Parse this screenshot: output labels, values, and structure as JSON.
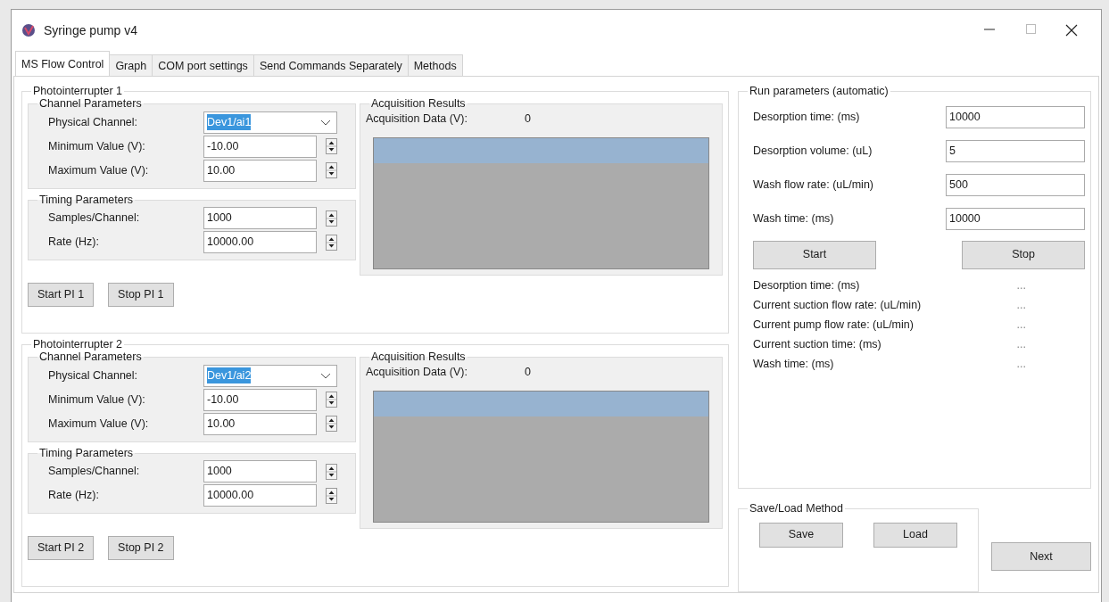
{
  "window": {
    "title": "Syringe pump v4"
  },
  "tabs": [
    {
      "label": "MS Flow Control",
      "selected": true
    },
    {
      "label": "Graph",
      "selected": false
    },
    {
      "label": "COM port settings",
      "selected": false
    },
    {
      "label": "Send Commands Separately",
      "selected": false
    },
    {
      "label": "Methods",
      "selected": false
    }
  ],
  "interrupters": [
    {
      "title": "Photointerrupter 1",
      "channel_params": {
        "title": "Channel Parameters",
        "physical_channel": {
          "label": "Physical Channel:",
          "value": "Dev1/ai1",
          "text_selected": true
        },
        "fields": [
          {
            "label": "Minimum Value (V):",
            "value": "-10.00"
          },
          {
            "label": "Maximum Value (V):",
            "value": "10.00"
          }
        ]
      },
      "timing": {
        "title": "Timing Parameters",
        "fields": [
          {
            "label": "Samples/Channel:",
            "value": "1000"
          },
          {
            "label": "Rate (Hz):",
            "value": "10000.00"
          }
        ]
      },
      "acquisition": {
        "title": "Acquisition Results",
        "data_label": "Acquisition Data (V):",
        "data_value": "0"
      },
      "buttons": [
        "Start PI 1",
        "Stop PI 1"
      ]
    },
    {
      "title": "Photointerrupter 2",
      "channel_params": {
        "title": "Channel Parameters",
        "physical_channel": {
          "label": "Physical Channel:",
          "value": "Dev1/ai2",
          "text_selected": true
        },
        "fields": [
          {
            "label": "Minimum Value (V):",
            "value": "-10.00"
          },
          {
            "label": "Maximum Value (V):",
            "value": "10.00"
          }
        ]
      },
      "timing": {
        "title": "Timing Parameters",
        "fields": [
          {
            "label": "Samples/Channel:",
            "value": "1000"
          },
          {
            "label": "Rate (Hz):",
            "value": "10000.00"
          }
        ]
      },
      "acquisition": {
        "title": "Acquisition Results",
        "data_label": "Acquisition Data (V):",
        "data_value": "0"
      },
      "buttons": [
        "Start PI 2",
        "Stop PI 2"
      ]
    }
  ],
  "run_params": {
    "title": "Run parameters (automatic)",
    "fields": [
      {
        "label": "Desorption time: (ms)",
        "value": "10000"
      },
      {
        "label": "Desorption volume: (uL)",
        "value": "5"
      },
      {
        "label": "Wash flow rate: (uL/min)",
        "value": "500"
      },
      {
        "label": "Wash time: (ms)",
        "value": "10000"
      }
    ],
    "buttons": [
      "Start",
      "Stop"
    ],
    "readouts": [
      {
        "label": "Desorption time: (ms)",
        "value": "..."
      },
      {
        "label": "Current suction flow rate: (uL/min)",
        "value": "..."
      },
      {
        "label": "Current pump flow rate: (uL/min)",
        "value": "..."
      },
      {
        "label": "Current suction time: (ms)",
        "value": "..."
      },
      {
        "label": "Wash time: (ms)",
        "value": "..."
      }
    ]
  },
  "save_load": {
    "title": "Save/Load Method",
    "buttons": [
      "Save",
      "Load"
    ]
  },
  "next_button": "Next"
}
